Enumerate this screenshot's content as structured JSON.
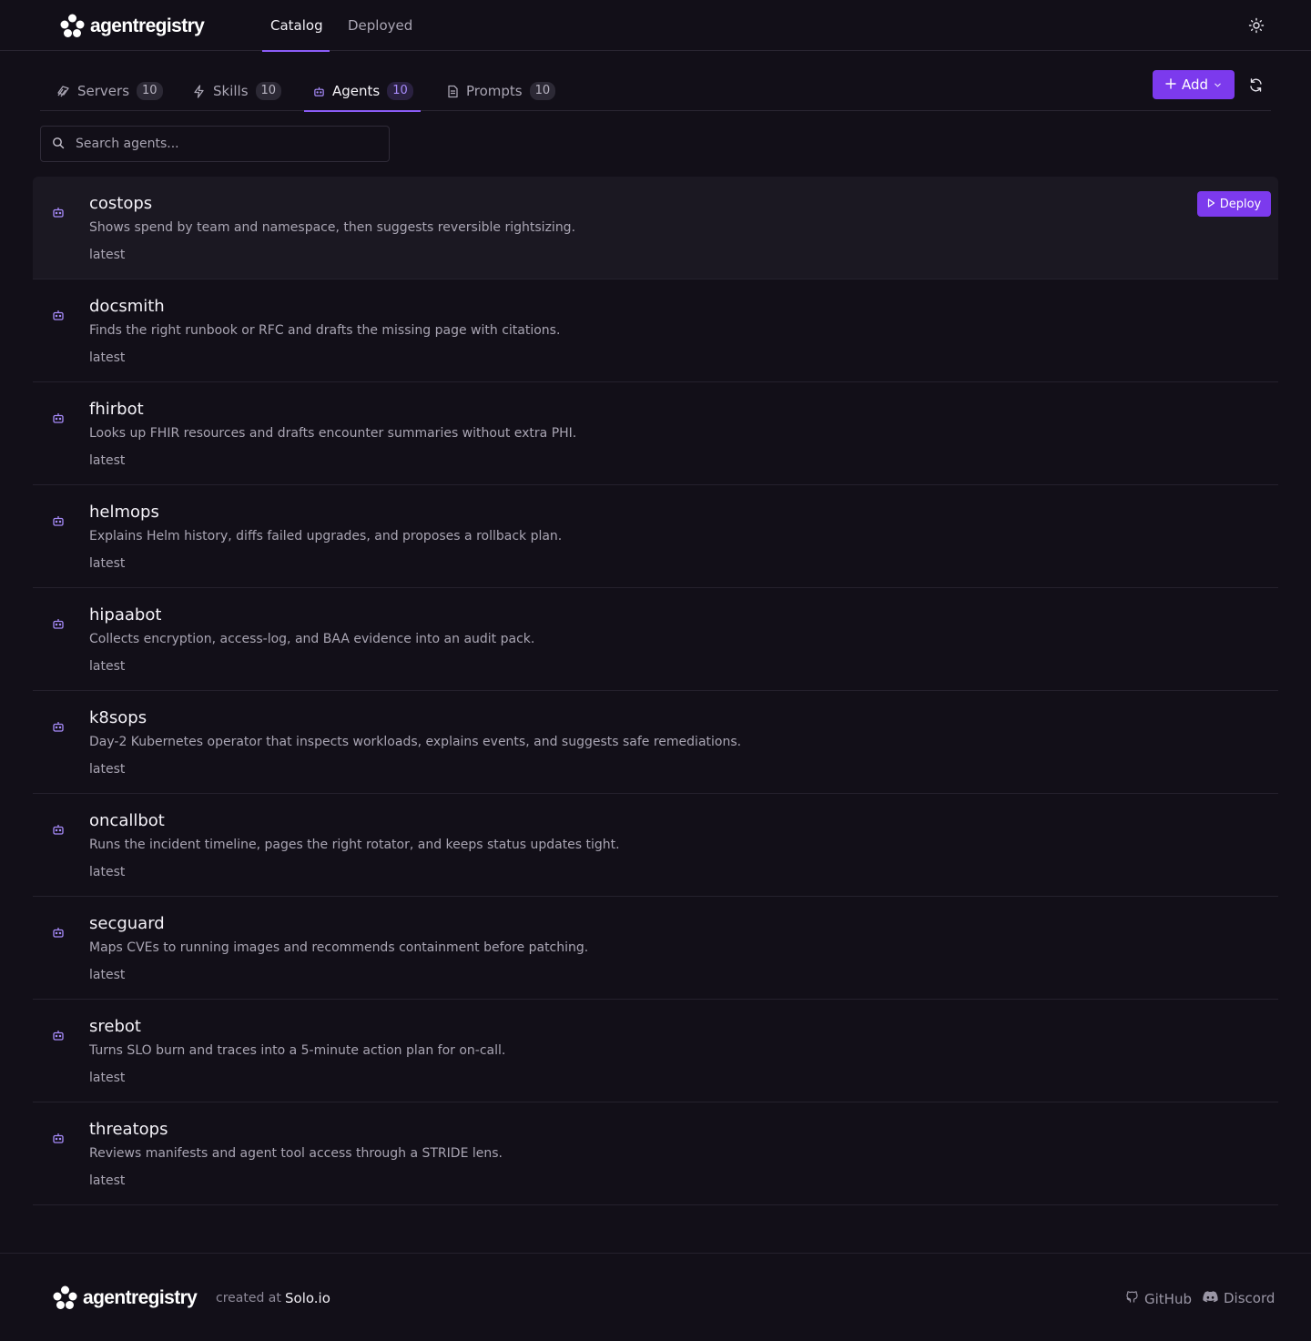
{
  "brand": {
    "name": "agentregistry"
  },
  "nav": {
    "catalog": "Catalog",
    "deployed": "Deployed"
  },
  "tabs": [
    {
      "label": "Servers",
      "count": "10"
    },
    {
      "label": "Skills",
      "count": "10"
    },
    {
      "label": "Agents",
      "count": "10"
    },
    {
      "label": "Prompts",
      "count": "10"
    }
  ],
  "actions": {
    "add_label": "Add",
    "deploy_label": "Deploy"
  },
  "search": {
    "placeholder": "Search agents..."
  },
  "agents": [
    {
      "name": "costops",
      "description": "Shows spend by team and namespace, then suggests reversible rightsizing.",
      "version": "latest"
    },
    {
      "name": "docsmith",
      "description": "Finds the right runbook or RFC and drafts the missing page with citations.",
      "version": "latest"
    },
    {
      "name": "fhirbot",
      "description": "Looks up FHIR resources and drafts encounter summaries without extra PHI.",
      "version": "latest"
    },
    {
      "name": "helmops",
      "description": "Explains Helm history, diffs failed upgrades, and proposes a rollback plan.",
      "version": "latest"
    },
    {
      "name": "hipaabot",
      "description": "Collects encryption, access-log, and BAA evidence into an audit pack.",
      "version": "latest"
    },
    {
      "name": "k8sops",
      "description": "Day-2 Kubernetes operator that inspects workloads, explains events, and suggests safe remediations.",
      "version": "latest"
    },
    {
      "name": "oncallbot",
      "description": "Runs the incident timeline, pages the right rotator, and keeps status updates tight.",
      "version": "latest"
    },
    {
      "name": "secguard",
      "description": "Maps CVEs to running images and recommends containment before patching.",
      "version": "latest"
    },
    {
      "name": "srebot",
      "description": "Turns SLO burn and traces into a 5-minute action plan for on-call.",
      "version": "latest"
    },
    {
      "name": "threatops",
      "description": "Reviews manifests and agent tool access through a STRIDE lens.",
      "version": "latest"
    }
  ],
  "footer": {
    "created_at": "created at",
    "company": "Solo.io",
    "github": "GitHub",
    "discord": "Discord"
  },
  "colors": {
    "accent": "#7c3aed",
    "background": "#120f18"
  }
}
